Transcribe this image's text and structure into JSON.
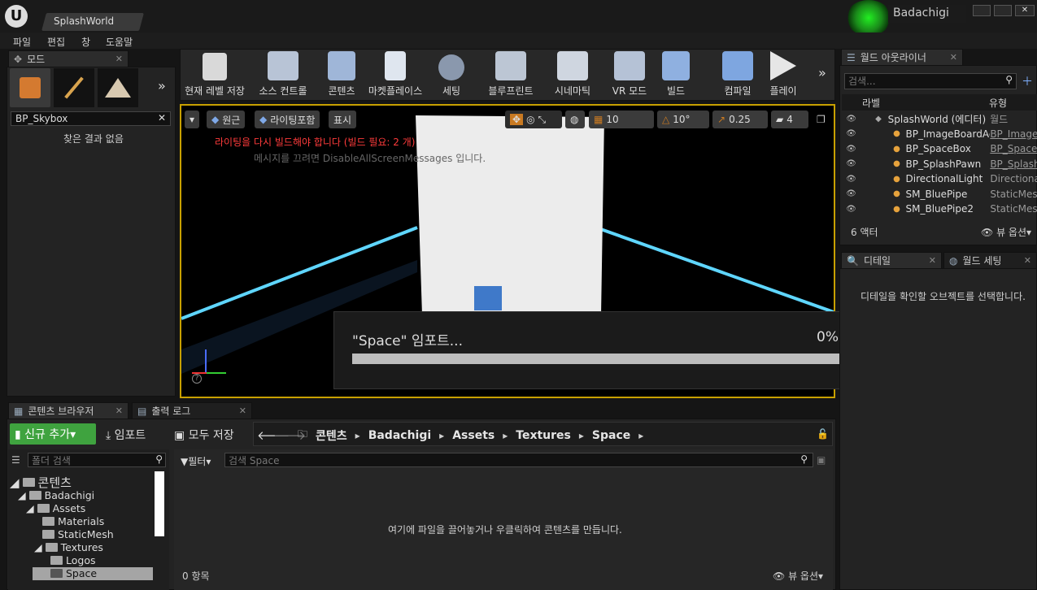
{
  "window": {
    "tab_title": "SplashWorld",
    "user": "Badachigi"
  },
  "menu": [
    "파일",
    "편집",
    "창",
    "도움말"
  ],
  "modes": {
    "tab_label": "모드",
    "search_value": "BP_Skybox",
    "no_results": "찾은 결과 없음"
  },
  "toolbar": {
    "items": [
      "현재 레벨 저장",
      "소스 컨트롤",
      "콘텐츠",
      "마켓플레이스",
      "세팅",
      "블루프린트",
      "시네마틱",
      "VR 모드",
      "빌드",
      "컴파일",
      "플레이"
    ]
  },
  "viewport": {
    "perspective": "원근",
    "lit": "라이팅포함",
    "show": "표시",
    "grid": "10",
    "rot": "10°",
    "scale": "0.25",
    "cam": "4",
    "warning": "라이팅을 다시 빌드해야 합니다 (빌드 필요: 2 개)",
    "hint": "메시지를 끄려면 DisableAllScreenMessages 입니다."
  },
  "import_dialog": {
    "title": "\"Space\" 임포트...",
    "percent": "0%",
    "progress": 0
  },
  "outliner": {
    "tab_label": "월드 아웃라이너",
    "search_placeholder": "검색...",
    "col_label": "라벨",
    "col_type": "유형",
    "rows": [
      {
        "label": "SplashWorld (에디터)",
        "type": "월드",
        "link": false
      },
      {
        "label": "BP_ImageBoardActor",
        "type": "BP_Image",
        "link": true
      },
      {
        "label": "BP_SpaceBox",
        "type": "BP_Space",
        "link": true
      },
      {
        "label": "BP_SplashPawn",
        "type": "BP_Splash",
        "link": true
      },
      {
        "label": "DirectionalLight",
        "type": "DirectionalL",
        "link": false
      },
      {
        "label": "SM_BluePipe",
        "type": "StaticMesh",
        "link": false
      },
      {
        "label": "SM_BluePipe2",
        "type": "StaticMesh",
        "link": false
      }
    ],
    "count": "6 액터",
    "view_options": "뷰 옵션"
  },
  "details": {
    "tab_label": "디테일",
    "world_tab": "월드 세팅",
    "hint": "디테일을 확인할 오브젝트를 선택합니다."
  },
  "content": {
    "tab_label": "콘텐츠 브라우저",
    "output_tab": "출력 로그",
    "add_new": "신규 추가",
    "import": "임포트",
    "save_all": "모두 저장",
    "crumbs": [
      "콘텐츠",
      "Badachigi",
      "Assets",
      "Textures",
      "Space"
    ],
    "folder_search": "폴더 검색",
    "filter": "필터",
    "search_placeholder": "검색 Space",
    "tree": [
      "콘텐츠",
      "Badachigi",
      "Assets",
      "Materials",
      "StaticMesh",
      "Textures",
      "Logos",
      "Space"
    ],
    "empty_hint": "여기에 파일을 끌어놓거나 우클릭하여 콘텐츠를 만듭니다.",
    "item_count": "0 항목",
    "view_options": "뷰 옵션"
  }
}
